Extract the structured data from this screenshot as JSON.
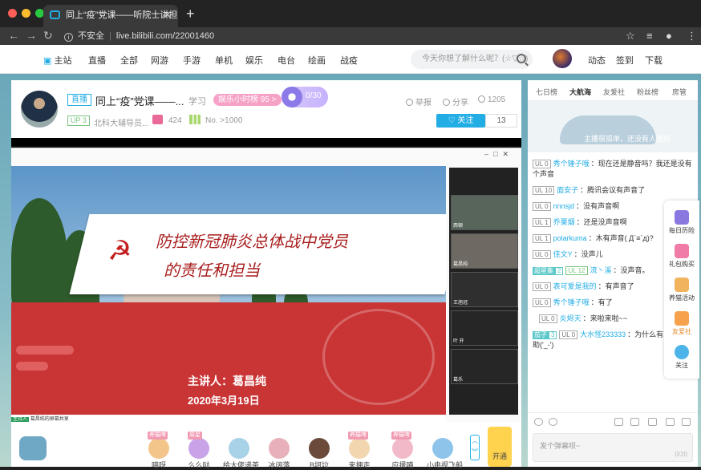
{
  "browser": {
    "tab_title": "同上“疫”党课——听院士讲担当",
    "new_tab": "+",
    "tab_close": "✕",
    "not_secure": "不安全",
    "url": "live.bilibili.com/22001460"
  },
  "header": {
    "home": "主站",
    "nav": [
      "直播",
      "全部",
      "网游",
      "手游",
      "单机",
      "娱乐",
      "电台",
      "绘画",
      "战疫"
    ],
    "search_placeholder": "今天你想了解什么呢？(☆▽☆)",
    "right": [
      "动态",
      "签到",
      "下载"
    ]
  },
  "room": {
    "live_badge": "直播",
    "title": "同上“疫”党课——...",
    "category": "学习",
    "rank": "娱乐小时榜 95 >",
    "guard": "0/30",
    "report": "举报",
    "share": "分享",
    "viewers": "1205",
    "up_level": "UP 3",
    "anchor": "北科大辅导员...",
    "gift_count": "424",
    "rank_no": "No. >1000",
    "follow": "关注",
    "followers": "13"
  },
  "slide": {
    "title_line1": "防控新冠肺炎总体战中党员",
    "title_line2": "的责任和担当",
    "speaker": "主讲人：葛昌纯",
    "date": "2020年3月19日",
    "share_caption": "葛昌纯的屏幕共享",
    "host_tag": "主持人"
  },
  "videos": [
    {
      "label": "西顿"
    },
    {
      "label": "葛昌纯"
    },
    {
      "label": "王旭冠"
    },
    {
      "label": "叶 开"
    },
    {
      "label": "葛乐"
    }
  ],
  "gifts": [
    {
      "tag": "养猫啤",
      "name": "喵呀"
    },
    {
      "tag": "周星",
      "name": "么么哒"
    },
    {
      "tag": "",
      "name": "给大佬递茶"
    },
    {
      "tag": "",
      "name": "冰阔落"
    },
    {
      "tag": "",
      "name": "B坷垃"
    },
    {
      "tag": "养猫啤",
      "name": "来拥走"
    },
    {
      "tag": "养猫啤",
      "name": "应援喵"
    },
    {
      "tag": "",
      "name": "小电视飞船"
    }
  ],
  "open_button": "开通",
  "chat": {
    "tabs": [
      "七日榜",
      "大航海",
      "友爱社",
      "粉丝榜",
      "房管"
    ],
    "active_tab": "大航海",
    "banner": "主播很孤单，还没有人登船",
    "messages": [
      {
        "level": "UL 0",
        "medal": "",
        "medal_lv": "",
        "user": "秀个锤子哦",
        "text": "：现在还是静音吗？我还是没有个声音"
      },
      {
        "level": "UL 10",
        "medal": "",
        "medal_lv": "",
        "user": "面安子",
        "text": "：腾讯会议有声音了"
      },
      {
        "level": "UL 0",
        "medal": "",
        "medal_lv": "",
        "user": "nnnsjd",
        "text": "：没有声音啊"
      },
      {
        "level": "UL 1",
        "medal": "",
        "medal_lv": "",
        "user": "乔栗烟",
        "text": "：还是没声音啊"
      },
      {
        "level": "UL 1",
        "medal": "",
        "medal_lv": "",
        "user": "polarkuma",
        "text": "：木有声音( Д´≡`д)?"
      },
      {
        "level": "UL 0",
        "medal": "",
        "medal_lv": "",
        "user": "佳文Y",
        "text": "：没声儿"
      },
      {
        "level": "UL 12",
        "medal": "超星集",
        "medal_lv": "2",
        "user": "流丶溪",
        "text": "：没声音。"
      },
      {
        "level": "UL 0",
        "medal": "",
        "medal_lv": "",
        "user": "表可爱是我的",
        "text": "：有声音了"
      },
      {
        "level": "UL 0",
        "medal": "",
        "medal_lv": "",
        "user": "秀个锤子哦",
        "text": "：有了"
      },
      {
        "level": "UL 0",
        "medal": "",
        "medal_lv": "",
        "user": "炎烬天",
        "text": "：来啦来啦~~"
      },
      {
        "level": "UL 0",
        "medal": "茄子",
        "medal_lv": "3",
        "user": "大水怪233333",
        "text": "：为什么有人只要赞助('_-')"
      }
    ],
    "input_placeholder": "发个弹幕呗~",
    "input_count": "0/20"
  },
  "float_panel": [
    "每日历险",
    "礼包购买",
    "养猫活动",
    "友爱社",
    "关注"
  ],
  "colors": {
    "accent": "#23ade5",
    "pink": "#f6a1c6",
    "red": "#c93435"
  }
}
